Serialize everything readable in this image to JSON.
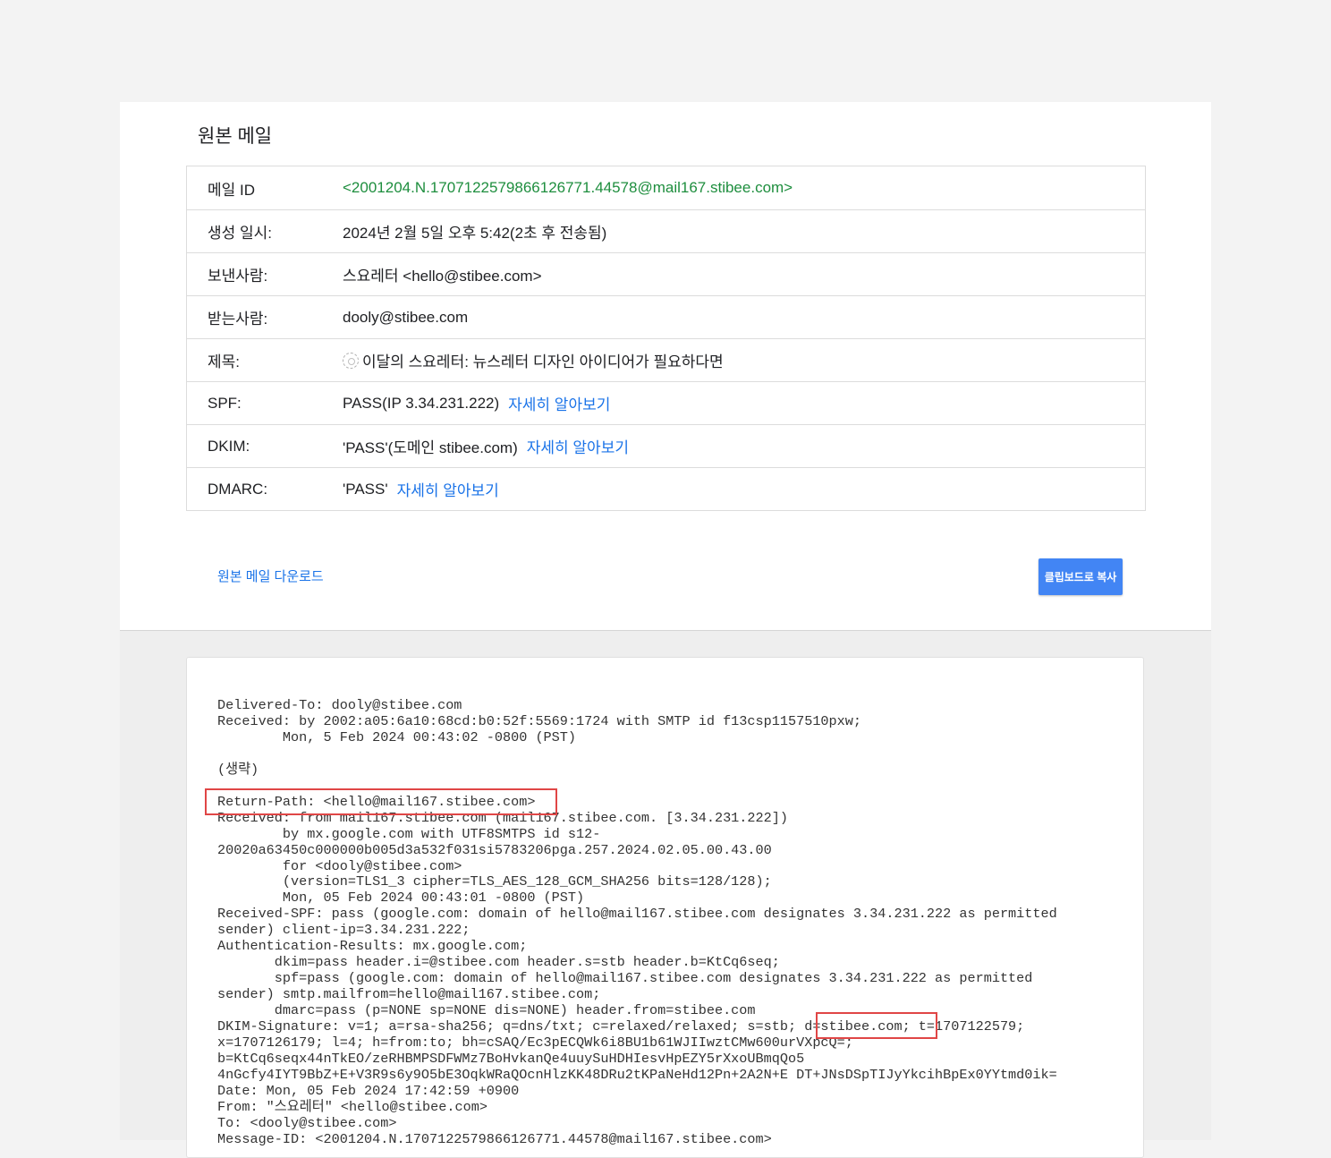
{
  "page": {
    "title": "원본 메일",
    "download_label": "원본 메일 다운로드",
    "copy_label": "클립보드로 복사"
  },
  "info": {
    "message_id": {
      "label": "메일 ID",
      "value": "<2001204.N.1707122579866126771.44578@mail167.stibee.com>"
    },
    "created": {
      "label": "생성 일시:",
      "value": "2024년 2월 5일 오후 5:42(2초 후 전송됨)"
    },
    "from": {
      "label": "보낸사람:",
      "value": "스요레터 <hello@stibee.com>"
    },
    "to": {
      "label": "받는사람:",
      "value": "dooly@stibee.com"
    },
    "subject": {
      "label": "제목:",
      "value": "이달의 스요레터: 뉴스레터 디자인 아이디어가 필요하다면"
    },
    "spf": {
      "label": "SPF:",
      "value": "PASS(IP 3.34.231.222)",
      "link": "자세히 알아보기"
    },
    "dkim": {
      "label": "DKIM:",
      "value": "'PASS'(도메인 stibee.com)",
      "link": "자세히 알아보기"
    },
    "dmarc": {
      "label": "DMARC:",
      "value": "'PASS'",
      "link": "자세히 알아보기"
    }
  },
  "raw": {
    "lines": [
      "Delivered-To: dooly@stibee.com",
      "Received: by 2002:a05:6a10:68cd:b0:52f:5569:1724 with SMTP id f13csp1157510pxw;",
      "        Mon, 5 Feb 2024 00:43:02 -0800 (PST)",
      "",
      "(생략)",
      "",
      "Return-Path: <hello@mail167.stibee.com>",
      "Received: from mail167.stibee.com (mail167.stibee.com. [3.34.231.222])",
      "        by mx.google.com with UTF8SMTPS id s12-",
      "20020a63450c000000b005d3a532f031si5783206pga.257.2024.02.05.00.43.00",
      "        for <dooly@stibee.com>",
      "        (version=TLS1_3 cipher=TLS_AES_128_GCM_SHA256 bits=128/128);",
      "        Mon, 05 Feb 2024 00:43:01 -0800 (PST)",
      "Received-SPF: pass (google.com: domain of hello@mail167.stibee.com designates 3.34.231.222 as permitted",
      "sender) client-ip=3.34.231.222;",
      "Authentication-Results: mx.google.com;",
      "       dkim=pass header.i=@stibee.com header.s=stb header.b=KtCq6seq;",
      "       spf=pass (google.com: domain of hello@mail167.stibee.com designates 3.34.231.222 as permitted",
      "sender) smtp.mailfrom=hello@mail167.stibee.com;",
      "       dmarc=pass (p=NONE sp=NONE dis=NONE) header.from=stibee.com",
      "DKIM-Signature: v=1; a=rsa-sha256; q=dns/txt; c=relaxed/relaxed; s=stb; d=stibee.com; t=1707122579;",
      "x=1707126179; l=4; h=from:to; bh=cSAQ/Ec3pECQWk6i8BU1b61WJIIwztCMw600urVXpcQ=;",
      "b=KtCq6seqx44nTkEO/zeRHBMPSDFWMz7BoHvkanQe4uuySuHDHIesvHpEZY5rXxoUBmqQo5",
      "4nGcfy4IYT9BbZ+E+V3R9s6y9O5bE3OqkWRaQOcnHlzKK48DRu2tKPaNeHd12Pn+2A2N+E DT+JNsDSpTIJyYkcihBpEx0YYtmd0ik=",
      "Date: Mon, 05 Feb 2024 17:42:59 +0900",
      "From: \"스요레터\" <hello@stibee.com>",
      "To: <dooly@stibee.com>",
      "Message-ID: <2001204.N.1707122579866126771.44578@mail167.stibee.com>"
    ]
  },
  "colors": {
    "message_id": "#1e8e3e",
    "link": "#1a73e8",
    "button": "#4285f4",
    "highlight": "#e04646"
  }
}
